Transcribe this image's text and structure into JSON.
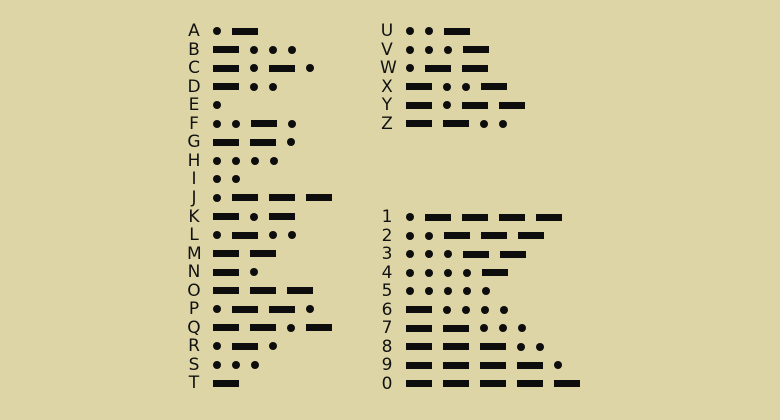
{
  "colors": {
    "background": "#ddd5a5",
    "ink": "#0d0d0d",
    "text": "#111111"
  },
  "groups": [
    {
      "name": "letters-a-t",
      "items": [
        {
          "char": "A",
          "code": ".-"
        },
        {
          "char": "B",
          "code": "-..."
        },
        {
          "char": "C",
          "code": "-.-."
        },
        {
          "char": "D",
          "code": "-.."
        },
        {
          "char": "E",
          "code": "."
        },
        {
          "char": "F",
          "code": "..-."
        },
        {
          "char": "G",
          "code": "--."
        },
        {
          "char": "H",
          "code": "...."
        },
        {
          "char": "I",
          "code": ".."
        },
        {
          "char": "J",
          "code": ".---"
        },
        {
          "char": "K",
          "code": "-.-"
        },
        {
          "char": "L",
          "code": ".-.."
        },
        {
          "char": "M",
          "code": "--"
        },
        {
          "char": "N",
          "code": "-."
        },
        {
          "char": "O",
          "code": "---"
        },
        {
          "char": "P",
          "code": ".--."
        },
        {
          "char": "Q",
          "code": "--.-"
        },
        {
          "char": "R",
          "code": ".-."
        },
        {
          "char": "S",
          "code": "..."
        },
        {
          "char": "T",
          "code": "-"
        }
      ]
    },
    {
      "name": "letters-u-z",
      "items": [
        {
          "char": "U",
          "code": "..-"
        },
        {
          "char": "V",
          "code": "...-"
        },
        {
          "char": "W",
          "code": ".--"
        },
        {
          "char": "X",
          "code": "-..-"
        },
        {
          "char": "Y",
          "code": "-.--"
        },
        {
          "char": "Z",
          "code": "--.."
        }
      ]
    },
    {
      "name": "digits",
      "items": [
        {
          "char": "1",
          "code": ".----"
        },
        {
          "char": "2",
          "code": "..---"
        },
        {
          "char": "3",
          "code": "...--"
        },
        {
          "char": "4",
          "code": "....-"
        },
        {
          "char": "5",
          "code": "....."
        },
        {
          "char": "6",
          "code": "-...."
        },
        {
          "char": "7",
          "code": "--..."
        },
        {
          "char": "8",
          "code": "---.."
        },
        {
          "char": "9",
          "code": "----."
        },
        {
          "char": "0",
          "code": "-----"
        }
      ]
    }
  ]
}
